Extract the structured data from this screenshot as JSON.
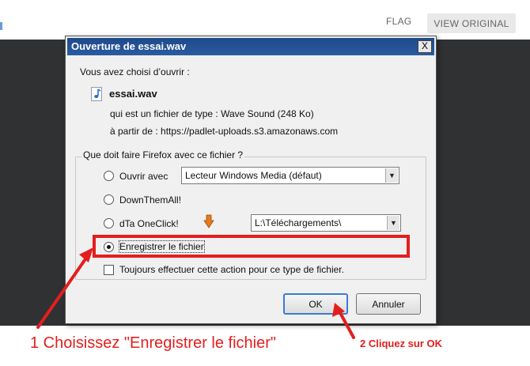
{
  "page": {
    "flag_label": "FLAG",
    "view_original_label": "VIEW ORIGINAL"
  },
  "dialog": {
    "title": "Ouverture de essai.wav",
    "close_label": "X",
    "intro": "Vous avez choisi d’ouvrir :",
    "file_name": "essai.wav",
    "type_line": "qui est un fichier de type : Wave Sound (248 Ko)",
    "from_line": "à partir de : https://padlet-uploads.s3.amazonaws.com",
    "question": "Que doit faire Firefox avec ce fichier ?",
    "options": {
      "open_with_label": "Ouvrir avec",
      "open_with_app": "Lecteur Windows Media (défaut)",
      "downthemall_label": "DownThemAll!",
      "dta_oneclick_label": "dTa OneClick!",
      "dta_folder": "L:\\Téléchargements\\",
      "save_label": "Enregistrer le fichier",
      "always_label": "Toujours effectuer cette action pour ce type de fichier."
    },
    "selected_option": "save",
    "always_checked": false,
    "ok_label": "OK",
    "cancel_label": "Annuler"
  },
  "annotations": {
    "step1": "1 Choisissez \"Enregistrer le fichier\"",
    "step2": "2 Cliquez sur OK",
    "color": "#e41e1e"
  },
  "icons": {
    "file": "audio-file-icon",
    "dta": "download-arrow-icon"
  }
}
